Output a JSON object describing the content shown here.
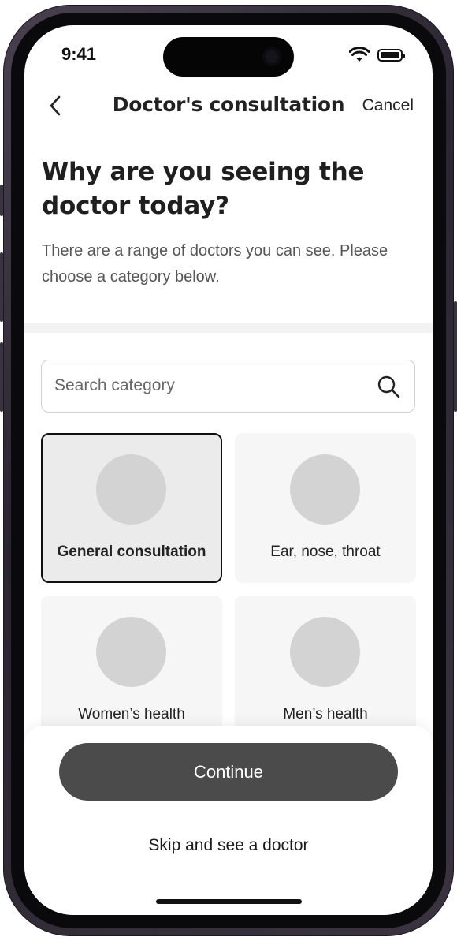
{
  "status_bar": {
    "time": "9:41"
  },
  "nav": {
    "title": "Doctor's consultation",
    "cancel_label": "Cancel"
  },
  "heading": "Why are you seeing the doctor today?",
  "subtext": "There are a range of doctors you can see. Please choose a category below.",
  "search": {
    "placeholder": "Search category"
  },
  "categories": [
    {
      "label": "General consultation",
      "selected": true
    },
    {
      "label": "Ear, nose, throat",
      "selected": false
    },
    {
      "label": "Women’s health",
      "selected": false
    },
    {
      "label": "Men’s health",
      "selected": false
    }
  ],
  "actions": {
    "continue_label": "Continue",
    "skip_label": "Skip and see a doctor"
  },
  "colors": {
    "primary_button": "#4b4b4b",
    "selected_border": "#111111",
    "card_bg": "#f6f6f6",
    "placeholder_circle": "#d3d3d3"
  }
}
